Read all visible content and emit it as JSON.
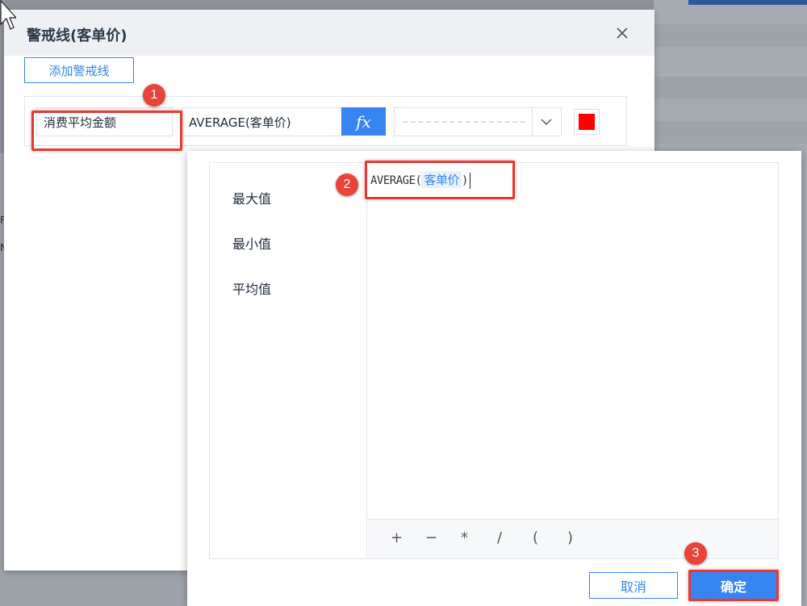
{
  "dialog": {
    "title": "警戒线(客单价)",
    "add_button_label": "添加警戒线",
    "row": {
      "name_value": "消费平均金额",
      "formula_value": "AVERAGE(客单价)",
      "fx_label": "fx",
      "line_style": "dashed",
      "color": "#ff0000"
    }
  },
  "formula_editor": {
    "functions": [
      "最大值",
      "最小值",
      "平均值"
    ],
    "formula": {
      "prefix": "AVERAGE(",
      "field": "客单价",
      "suffix": ")"
    },
    "operators": [
      "+",
      "−",
      "*",
      "/",
      "(",
      ")"
    ],
    "cancel_label": "取消",
    "confirm_label": "确定"
  },
  "annotations": {
    "step1": "1",
    "step2": "2",
    "step3": "3"
  },
  "background": {
    "left_text_1": "F",
    "left_text_2": "N"
  },
  "colors": {
    "accent": "#3685f2",
    "highlight": "#e53935"
  },
  "icons": {
    "close": "close-icon",
    "dropdown": "chevron-down-icon",
    "cursor": "mouse-pointer-icon"
  }
}
